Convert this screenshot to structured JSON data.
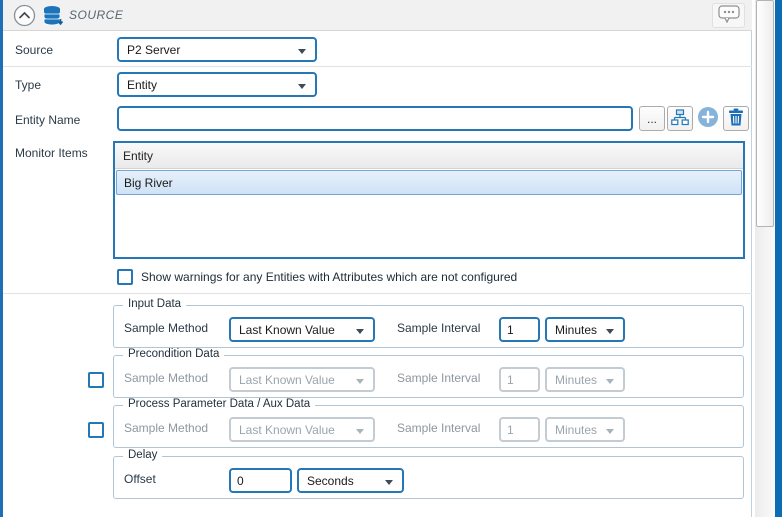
{
  "header": {
    "title": "SOURCE",
    "collapse_icon": "chevron-up-circle",
    "panel_icon": "database",
    "comment_icon": "speech-bubble-ellipsis"
  },
  "form": {
    "source": {
      "label": "Source",
      "value": "P2 Server"
    },
    "type": {
      "label": "Type",
      "value": "Entity"
    },
    "entity_name": {
      "label": "Entity Name",
      "value": "",
      "browse_button": "...",
      "hierarchy_button_icon": "org-chart",
      "add_button_icon": "plus-circle",
      "delete_button_icon": "trash"
    },
    "monitor_items": {
      "label": "Monitor Items",
      "column_header": "Entity",
      "rows": [
        "Big River"
      ],
      "selected_row": "Big River"
    },
    "warnings_checkbox": {
      "checked": false,
      "label": "Show warnings for any Entities with Attributes which are not configured"
    }
  },
  "groups": {
    "input_data": {
      "title": "Input Data",
      "sample_method_label": "Sample Method",
      "sample_method_value": "Last Known Value",
      "sample_interval_label": "Sample Interval",
      "sample_interval_value": "1",
      "interval_unit": "Minutes",
      "enabled": true
    },
    "precondition": {
      "title": "Precondition Data",
      "sample_method_label": "Sample Method",
      "sample_method_value": "Last Known Value",
      "sample_interval_label": "Sample Interval",
      "sample_interval_value": "1",
      "interval_unit": "Minutes",
      "enabled": false,
      "checkbox_checked": false
    },
    "process_parameter": {
      "title": "Process Parameter Data / Aux Data",
      "sample_method_label": "Sample Method",
      "sample_method_value": "Last Known Value",
      "sample_interval_label": "Sample Interval",
      "sample_interval_value": "1",
      "interval_unit": "Minutes",
      "enabled": false,
      "checkbox_checked": false
    },
    "delay": {
      "title": "Delay",
      "offset_label": "Offset",
      "offset_value": "0",
      "unit": "Seconds"
    }
  },
  "colors": {
    "accent_blue": "#2577b5",
    "icon_blue": "#1d74bb",
    "edge_stripe_left": "#1d70b7",
    "edge_stripe_right": "#0e6cb3",
    "header_bg": "#f1f1f1",
    "disabled_border": "#c3ccd3",
    "disabled_text": "#9aa4ab",
    "selected_row_border": "#74a4d5",
    "selected_row_bg": "#cfe2f6"
  }
}
